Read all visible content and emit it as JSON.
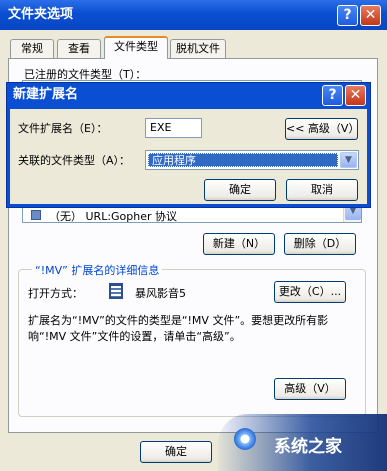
{
  "window": {
    "title": "文件夹选项",
    "help_label": "?",
    "close_label": "✕"
  },
  "tabs": [
    {
      "label": "常规"
    },
    {
      "label": "查看"
    },
    {
      "label": "文件类型"
    },
    {
      "label": "脱机文件"
    }
  ],
  "registered_types_label": "已注册的文件类型（T）：",
  "list_partial_row": "（无）  URL:Gopher 协议",
  "buttons": {
    "new": "新建（N）",
    "delete": "删除（D）",
    "change": "更改（C）...",
    "advanced": "高级（V）",
    "ok": "确定"
  },
  "details": {
    "group_title": "“!MV” 扩展名的详细信息",
    "open_with_label": "打开方式：",
    "open_with_app": "暴风影音5",
    "description": "扩展名为“!MV”的文件的类型是“!MV 文件”。要想更改所有影响“!MV 文件”文件的设置，请单击“高级”。"
  },
  "new_ext_dialog": {
    "title": "新建扩展名",
    "help_label": "?",
    "close_label": "✕",
    "ext_label": "文件扩展名（E）：",
    "ext_value": "EXE",
    "advanced_label": "<< 高级（V）",
    "assoc_label": "关联的文件类型（A）：",
    "assoc_value": "应用程序",
    "ok_label": "确定",
    "cancel_label": "取消"
  },
  "watermark": {
    "brand": "系统之家"
  }
}
